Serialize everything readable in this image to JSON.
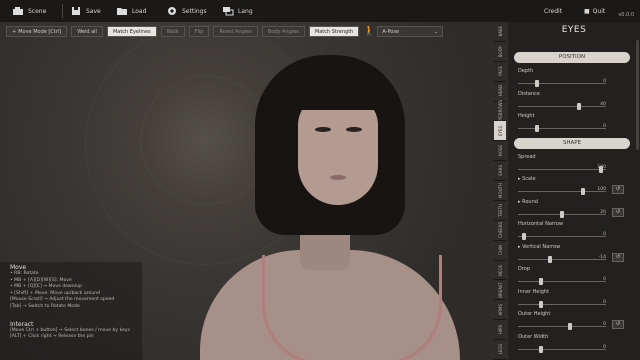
{
  "topbar": {
    "items": [
      {
        "label": "Scene",
        "icon": "camera-icon"
      },
      {
        "label": "Save",
        "icon": "save-icon"
      },
      {
        "label": "Load",
        "icon": "folder-icon"
      },
      {
        "label": "Settings",
        "icon": "gear-icon"
      },
      {
        "label": "Lang",
        "icon": "lang-icon"
      }
    ],
    "credit": "Credit",
    "quit": "Quit",
    "version": "v0.0.0"
  },
  "toolbar2": {
    "buttons": [
      {
        "label": "Move Mode [Ctrl]",
        "state": "normal"
      },
      {
        "label": "Weld all",
        "state": "normal"
      },
      {
        "label": "Match Eyelines",
        "state": "active"
      },
      {
        "label": "Walk",
        "state": "dim"
      },
      {
        "label": "Flip",
        "state": "dim"
      },
      {
        "label": "Reset Angles",
        "state": "dim"
      },
      {
        "label": "Body Angles",
        "state": "dim"
      },
      {
        "label": "Match Strength",
        "state": "active"
      }
    ],
    "dropdown": "A-Pose"
  },
  "help": {
    "move_title": "Move",
    "move_lines": [
      "• RB: Rotate",
      "• MB + [A][D][W][S]: Move",
      "• MB + [Q][E] → Move down/up",
      "• [Shift] + Move: Move up/back around",
      "[Mouse Scroll] → Adjust the movement speed",
      "[Tab] → Switch to Rotate Mode"
    ],
    "interact_title": "Interact",
    "interact_lines": [
      "[Move Ctrl + button] → Select bones / move by keys",
      "[ALT] + Click right → Release the pin"
    ]
  },
  "vtabs": [
    "BASE",
    "BODY",
    "FACE",
    "HEAD",
    "EYEBROWS",
    "EYES",
    "NOSE",
    "EARS",
    "MOUTH",
    "TEETH",
    "CHEEKS",
    "CHIN",
    "NECK",
    "BREAST",
    "ARMS",
    "HIPS",
    "LEGS"
  ],
  "vtab_active": "EYES",
  "panel": {
    "title": "EYES",
    "sections": [
      {
        "name": "POSITION",
        "sliders": [
          {
            "label": "Depth",
            "value": "0",
            "pos": 0.2,
            "reset": false
          },
          {
            "label": "Distance",
            "value": "40",
            "pos": 0.7,
            "reset": false
          },
          {
            "label": "Height",
            "value": "0",
            "pos": 0.2,
            "reset": false
          }
        ]
      },
      {
        "name": "SHAPE",
        "sliders": [
          {
            "label": "Spread",
            "value": "100",
            "pos": 0.97,
            "reset": false
          },
          {
            "label": "▸ Scale",
            "value": "100",
            "pos": 0.75,
            "reset": true
          },
          {
            "label": "▸ Round",
            "value": "20",
            "pos": 0.5,
            "reset": true
          },
          {
            "label": "Horizontal Narrow",
            "value": "0",
            "pos": 0.05,
            "reset": false
          },
          {
            "label": "▸ Vertical Narrow",
            "value": "-14",
            "pos": 0.36,
            "reset": true
          },
          {
            "label": "Drop",
            "value": "0",
            "pos": 0.25,
            "reset": false
          },
          {
            "label": "Inner Height",
            "value": "0",
            "pos": 0.25,
            "reset": false
          },
          {
            "label": "Outer Height",
            "value": "0",
            "pos": 0.6,
            "reset": true
          },
          {
            "label": "Outer Width",
            "value": "0",
            "pos": 0.25,
            "reset": false
          }
        ]
      }
    ]
  },
  "colors": {
    "panel": "#232120",
    "pill": "#d9d3cd",
    "topbar": "#1b1917"
  }
}
